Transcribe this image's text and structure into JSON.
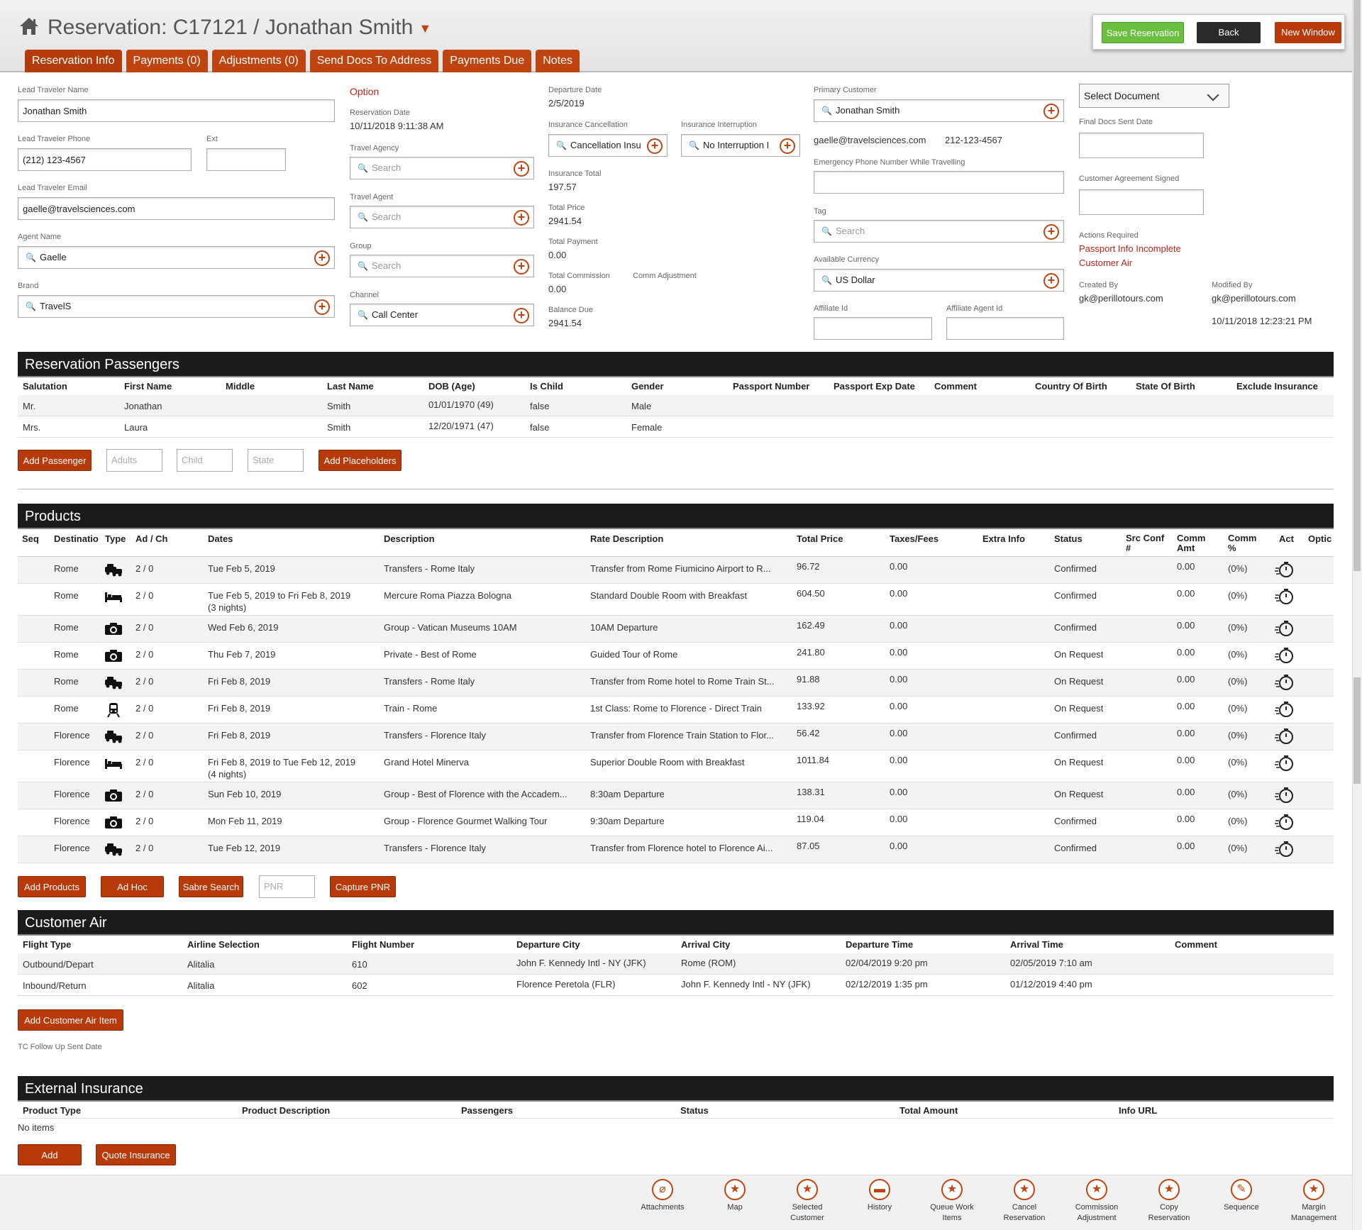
{
  "header": {
    "title": "Reservation: C17121 / Jonathan Smith",
    "tabs": [
      "Reservation Info",
      "Payments (0)",
      "Adjustments (0)",
      "Send Docs To Address",
      "Payments Due",
      "Notes"
    ],
    "save": "Save Reservation",
    "back": "Back",
    "new_window": "New Window"
  },
  "col1": {
    "lead_name_label": "Lead Traveler Name",
    "lead_name": "Jonathan Smith",
    "phone_label": "Lead Traveler Phone",
    "phone": "(212) 123-4567",
    "ext_label": "Ext",
    "ext": "",
    "email_label": "Lead Traveler Email",
    "email": "gaelle@travelsciences.com",
    "agent_label": "Agent Name",
    "agent": "Gaelle",
    "brand_label": "Brand",
    "brand": "TravelS"
  },
  "col2": {
    "status": "Option",
    "res_date_label": "Reservation Date",
    "res_date": "10/11/2018 9:11:38 AM",
    "agency_label": "Travel Agency",
    "agent_label": "Travel Agent",
    "group_label": "Group",
    "channel_label": "Channel",
    "channel": "Call Center",
    "search_placeholder": "Search"
  },
  "col3": {
    "dep_date_label": "Departure Date",
    "dep_date": "2/5/2019",
    "ins_cancel_label": "Insurance Cancellation",
    "ins_cancel": "Cancellation Insu",
    "ins_interrupt_label": "Insurance Interruption",
    "ins_interrupt": "No Interruption I",
    "ins_total_label": "Insurance Total",
    "ins_total": "197.57",
    "total_price_label": "Total Price",
    "total_price": "2941.54",
    "total_payment_label": "Total Payment",
    "total_payment": "0.00",
    "total_comm_label": "Total Commission",
    "total_comm": "0.00",
    "comm_adj_label": "Comm Adjustment",
    "balance_label": "Balance Due",
    "balance": "2941.54"
  },
  "col4": {
    "primary_label": "Primary Customer",
    "primary": "Jonathan Smith",
    "email": "gaelle@travelsciences.com",
    "phone": "212-123-4567",
    "emerg_label": "Emergency Phone Number While Travelling",
    "tag_label": "Tag",
    "tag_placeholder": "Search",
    "currency_label": "Available Currency",
    "currency": "US Dollar",
    "affiliate_label": "Affiliate Id",
    "affiliate_agent_label": "Affiliate Agent Id"
  },
  "col5": {
    "select_doc": "Select Document",
    "final_docs_label": "Final Docs Sent Date",
    "agreement_label": "Customer Agreement Signed",
    "actions_label": "Actions Required",
    "action1": "Passport Info Incomplete",
    "action2": "Customer Air",
    "created_label": "Created By",
    "created": "gk@perillotours.com",
    "modified_label": "Modified By",
    "modified": "gk@perillotours.com",
    "modified_date": "10/11/2018 12:23:21 PM"
  },
  "passengers": {
    "title": "Reservation Passengers",
    "headers": [
      "Salutation",
      "First Name",
      "Middle",
      "Last Name",
      "DOB (Age)",
      "Is Child",
      "Gender",
      "Passport Number",
      "Passport Exp Date",
      "Comment",
      "Country Of Birth",
      "State Of Birth",
      "Exclude Insurance"
    ],
    "rows": [
      {
        "sal": "Mr.",
        "first": "Jonathan",
        "last": "Smith",
        "dob": "01/01/1970 (49)",
        "child": "false",
        "gender": "Male"
      },
      {
        "sal": "Mrs.",
        "first": "Laura",
        "last": "Smith",
        "dob": "12/20/1971 (47)",
        "child": "false",
        "gender": "Female"
      }
    ],
    "add": "Add Passenger",
    "adults_ph": "Adults",
    "child_ph": "Child",
    "state_ph": "State",
    "add_placeholders": "Add Placeholders"
  },
  "products": {
    "title": "Products",
    "headers": {
      "seq": "Seq",
      "dest": "Destinatio",
      "type": "Type",
      "adch": "Ad / Ch",
      "dates": "Dates",
      "desc": "Description",
      "rate": "Rate Description",
      "price": "Total Price",
      "taxes": "Taxes/Fees",
      "extra": "Extra Info",
      "status": "Status",
      "src1": "Src Conf",
      "src2": "#",
      "comm1": "Comm",
      "comm2": "Amt",
      "commp1": "Comm",
      "commp2": "%",
      "act": "Act",
      "opt": "Optic"
    },
    "rows": [
      {
        "dest": "Rome",
        "icon": "car",
        "adch": "2 / 0",
        "dates": "Tue Feb 5, 2019",
        "nights": "",
        "desc": "Transfers - Rome Italy",
        "rate": "Transfer from Rome Fiumicino Airport to R...",
        "price": "96.72",
        "taxes": "0.00",
        "status": "Confirmed",
        "comm": "0.00",
        "pct": "(0%)"
      },
      {
        "dest": "Rome",
        "icon": "bed",
        "adch": "2 / 0",
        "dates": "Tue Feb 5, 2019 to Fri Feb 8, 2019",
        "nights": "(3 nights)",
        "desc": "Mercure Roma Piazza Bologna",
        "rate": "Standard Double Room with Breakfast",
        "price": "604.50",
        "taxes": "0.00",
        "status": "Confirmed",
        "comm": "0.00",
        "pct": "(0%)"
      },
      {
        "dest": "Rome",
        "icon": "camera",
        "adch": "2 / 0",
        "dates": "Wed Feb 6, 2019",
        "nights": "",
        "desc": "Group - Vatican Museums 10AM",
        "rate": "10AM Departure",
        "price": "162.49",
        "taxes": "0.00",
        "status": "Confirmed",
        "comm": "0.00",
        "pct": "(0%)"
      },
      {
        "dest": "Rome",
        "icon": "camera",
        "adch": "2 / 0",
        "dates": "Thu Feb 7, 2019",
        "nights": "",
        "desc": "Private - Best of Rome",
        "rate": "Guided Tour of Rome",
        "price": "241.80",
        "taxes": "0.00",
        "status": "On Request",
        "comm": "0.00",
        "pct": "(0%)"
      },
      {
        "dest": "Rome",
        "icon": "car",
        "adch": "2 / 0",
        "dates": "Fri Feb 8, 2019",
        "nights": "",
        "desc": "Transfers - Rome Italy",
        "rate": "Transfer from Rome hotel to Rome Train St...",
        "price": "91.88",
        "taxes": "0.00",
        "status": "On Request",
        "comm": "0.00",
        "pct": "(0%)"
      },
      {
        "dest": "Rome",
        "icon": "train",
        "adch": "2 / 0",
        "dates": "Fri Feb 8, 2019",
        "nights": "",
        "desc": "Train - Rome",
        "rate": "1st Class: Rome to Florence - Direct Train",
        "price": "133.92",
        "taxes": "0.00",
        "status": "On Request",
        "comm": "0.00",
        "pct": "(0%)"
      },
      {
        "dest": "Florence",
        "icon": "car",
        "adch": "2 / 0",
        "dates": "Fri Feb 8, 2019",
        "nights": "",
        "desc": "Transfers - Florence Italy",
        "rate": "Transfer from Florence Train Station to Flor...",
        "price": "56.42",
        "taxes": "0.00",
        "status": "Confirmed",
        "comm": "0.00",
        "pct": "(0%)"
      },
      {
        "dest": "Florence",
        "icon": "bed",
        "adch": "2 / 0",
        "dates": "Fri Feb 8, 2019 to Tue Feb 12, 2019",
        "nights": "(4 nights)",
        "desc": "Grand Hotel Minerva",
        "rate": "Superior Double Room with Breakfast",
        "price": "1011.84",
        "taxes": "0.00",
        "status": "On Request",
        "comm": "0.00",
        "pct": "(0%)"
      },
      {
        "dest": "Florence",
        "icon": "camera",
        "adch": "2 / 0",
        "dates": "Sun Feb 10, 2019",
        "nights": "",
        "desc": "Group - Best of Florence with the Accadem...",
        "rate": "8:30am Departure",
        "price": "138.31",
        "taxes": "0.00",
        "status": "On Request",
        "comm": "0.00",
        "pct": "(0%)"
      },
      {
        "dest": "Florence",
        "icon": "camera",
        "adch": "2 / 0",
        "dates": "Mon Feb 11, 2019",
        "nights": "",
        "desc": "Group - Florence Gourmet Walking Tour",
        "rate": "9:30am Departure",
        "price": "119.04",
        "taxes": "0.00",
        "status": "Confirmed",
        "comm": "0.00",
        "pct": "(0%)"
      },
      {
        "dest": "Florence",
        "icon": "car",
        "adch": "2 / 0",
        "dates": "Tue Feb 12, 2019",
        "nights": "",
        "desc": "Transfers - Florence Italy",
        "rate": "Transfer from Florence hotel to Florence Ai...",
        "price": "87.05",
        "taxes": "0.00",
        "status": "Confirmed",
        "comm": "0.00",
        "pct": "(0%)"
      }
    ],
    "add": "Add Products",
    "adhoc": "Ad Hoc",
    "sabre": "Sabre Search",
    "pnr_ph": "PNR",
    "capture": "Capture PNR"
  },
  "air": {
    "title": "Customer Air",
    "headers": [
      "Flight Type",
      "Airline Selection",
      "Flight Number",
      "Departure City",
      "Arrival City",
      "Departure Time",
      "Arrival Time",
      "Comment"
    ],
    "rows": [
      [
        "Outbound/Depart",
        "Alitalia",
        "610",
        "John F. Kennedy Intl - NY (JFK)",
        "Rome (ROM)",
        "02/04/2019 9:20 pm",
        "02/05/2019 7:10 am",
        ""
      ],
      [
        "Inbound/Return",
        "Alitalia",
        "602",
        "Florence Peretola (FLR)",
        "John F. Kennedy Intl - NY (JFK)",
        "02/12/2019 1:35 pm",
        "01/12/2019 4:40 pm",
        ""
      ]
    ],
    "add": "Add Customer Air Item",
    "followup_label": "TC Follow Up Sent Date"
  },
  "insurance": {
    "title": "External Insurance",
    "headers": [
      "Product Type",
      "Product Description",
      "Passengers",
      "Status",
      "Total Amount",
      "Info URL"
    ],
    "empty": "No items",
    "add": "Add",
    "quote": "Quote Insurance"
  },
  "footer": [
    {
      "l1": "Attachments",
      "l2": "",
      "icon": "paperclip-icon",
      "glyph": "⌀"
    },
    {
      "l1": "Map",
      "l2": "",
      "icon": "star-icon",
      "glyph": "★"
    },
    {
      "l1": "Selected",
      "l2": "Customer",
      "icon": "star-icon",
      "glyph": "★"
    },
    {
      "l1": "History",
      "l2": "",
      "icon": "folder-icon",
      "glyph": "▬"
    },
    {
      "l1": "Queue Work",
      "l2": "Items",
      "icon": "star-icon",
      "glyph": "★"
    },
    {
      "l1": "Cancel",
      "l2": "Reservation",
      "icon": "star-icon",
      "glyph": "★"
    },
    {
      "l1": "Commission",
      "l2": "Adjustment",
      "icon": "star-icon",
      "glyph": "★"
    },
    {
      "l1": "Copy",
      "l2": "Reservation",
      "icon": "star-icon",
      "glyph": "★"
    },
    {
      "l1": "Sequence",
      "l2": "",
      "icon": "pencil-icon",
      "glyph": "✎"
    },
    {
      "l1": "Margin",
      "l2": "Management",
      "icon": "star-icon",
      "glyph": "★"
    }
  ],
  "colors": {
    "accent": "#c0440f",
    "save": "#6bbf3f",
    "dark": "#1c1c1c",
    "error": "#c0221a"
  }
}
